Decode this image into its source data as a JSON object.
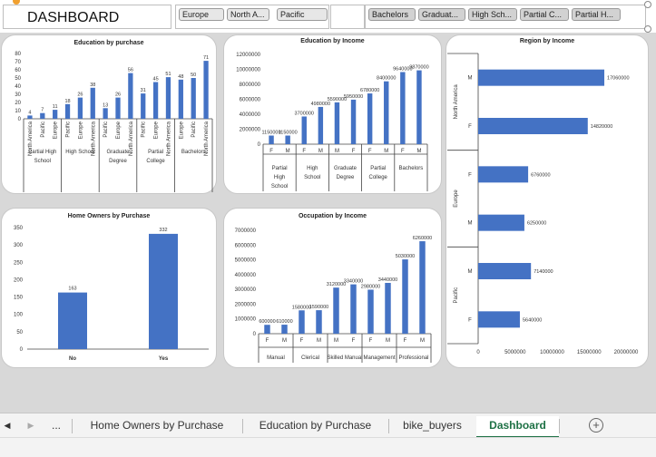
{
  "dashboard_title": "DASHBOARD",
  "region_slicer": {
    "items": [
      "Europe",
      "North A...",
      "Pacific"
    ]
  },
  "education_slicer": {
    "items": [
      "Bachelors",
      "Graduat...",
      "High Sch...",
      "Partial C...",
      "Partial H..."
    ]
  },
  "tabs": {
    "prev": "◀",
    "next": "▶",
    "more": "...",
    "items": [
      "Home Owners by Purchase",
      "Education by Purchase",
      "bike_buyers",
      "Dashboard"
    ],
    "active": "Dashboard",
    "add": "+"
  },
  "colors": {
    "bar": "#4472c4",
    "active_tab": "#1e7145"
  },
  "chart_data": [
    {
      "id": "edu_purchase",
      "type": "bar",
      "title": "Education by purchase",
      "ylim": [
        0,
        80
      ],
      "yticks": [
        0,
        10,
        20,
        30,
        40,
        50,
        60,
        70,
        80
      ],
      "groups": [
        {
          "label": [
            "Partial High",
            "School"
          ],
          "cats": [
            "North America",
            "Pacific",
            "Europe"
          ],
          "values": [
            4,
            7,
            11
          ]
        },
        {
          "label": [
            "High School"
          ],
          "cats": [
            "Pacific",
            "Europe",
            "North America"
          ],
          "values": [
            18,
            26,
            38
          ]
        },
        {
          "label": [
            "Graduate",
            "Degree"
          ],
          "cats": [
            "Pacific",
            "Europe",
            "North America"
          ],
          "values": [
            13,
            26,
            56
          ]
        },
        {
          "label": [
            "Partial",
            "College"
          ],
          "cats": [
            "Pacific",
            "Europe",
            "North America"
          ],
          "values": [
            31,
            45,
            51
          ]
        },
        {
          "label": [
            "Bachelors"
          ],
          "cats": [
            "Europe",
            "Pacific",
            "North America"
          ],
          "values": [
            48,
            50,
            71
          ]
        }
      ]
    },
    {
      "id": "edu_income",
      "type": "bar",
      "title": "Education by Income",
      "ylim": [
        0,
        12000000
      ],
      "yticks": [
        0,
        2000000,
        4000000,
        6000000,
        8000000,
        10000000,
        12000000
      ],
      "groups": [
        {
          "label": [
            "Partial",
            "High",
            "School"
          ],
          "cats": [
            "F",
            "M"
          ],
          "values": [
            1150000,
            1150000
          ]
        },
        {
          "label": [
            "High",
            "School"
          ],
          "cats": [
            "F",
            "M"
          ],
          "values": [
            3700000,
            4980000
          ]
        },
        {
          "label": [
            "Graduate",
            "Degree"
          ],
          "cats": [
            "M",
            "F"
          ],
          "values": [
            5590000,
            5950000
          ]
        },
        {
          "label": [
            "Partial",
            "College"
          ],
          "cats": [
            "F",
            "M"
          ],
          "values": [
            6780000,
            8400000
          ]
        },
        {
          "label": [
            "Bachelors"
          ],
          "cats": [
            "F",
            "M"
          ],
          "values": [
            9640000,
            9870000
          ]
        }
      ]
    },
    {
      "id": "home_owners",
      "type": "bar",
      "title": "Home Owners by Purchase",
      "ylim": [
        0,
        350
      ],
      "yticks": [
        0,
        50,
        100,
        150,
        200,
        250,
        300,
        350
      ],
      "categories": [
        "No",
        "Yes"
      ],
      "values": [
        163,
        332
      ]
    },
    {
      "id": "occ_income",
      "type": "bar",
      "title": "Occupation by Income",
      "ylim": [
        0,
        7000000
      ],
      "yticks": [
        0,
        1000000,
        2000000,
        3000000,
        4000000,
        5000000,
        6000000,
        7000000
      ],
      "groups": [
        {
          "label": [
            "Manual"
          ],
          "cats": [
            "F",
            "M"
          ],
          "values": [
            600000,
            610000
          ]
        },
        {
          "label": [
            "Clerical"
          ],
          "cats": [
            "F",
            "M"
          ],
          "values": [
            1580000,
            1590000
          ]
        },
        {
          "label": [
            "Skilled Manual"
          ],
          "cats": [
            "M",
            "F"
          ],
          "values": [
            3120000,
            3340000
          ]
        },
        {
          "label": [
            "Management"
          ],
          "cats": [
            "F",
            "M"
          ],
          "values": [
            2980000,
            3440000
          ]
        },
        {
          "label": [
            "Professional"
          ],
          "cats": [
            "F",
            "M"
          ],
          "values": [
            5030000,
            6260000
          ]
        }
      ]
    },
    {
      "id": "region_income",
      "type": "bar",
      "orientation": "horizontal",
      "title": "Region by Income",
      "xlim": [
        0,
        20000000
      ],
      "xticks": [
        0,
        5000000,
        10000000,
        15000000,
        20000000
      ],
      "groups": [
        {
          "label": "North America",
          "cats": [
            "M",
            "F"
          ],
          "values": [
            17060000,
            14820000
          ]
        },
        {
          "label": "Europe",
          "cats": [
            "F",
            "M"
          ],
          "values": [
            6760000,
            6250000
          ]
        },
        {
          "label": "Pacific",
          "cats": [
            "M",
            "F"
          ],
          "values": [
            7140000,
            5640000
          ]
        }
      ]
    }
  ]
}
